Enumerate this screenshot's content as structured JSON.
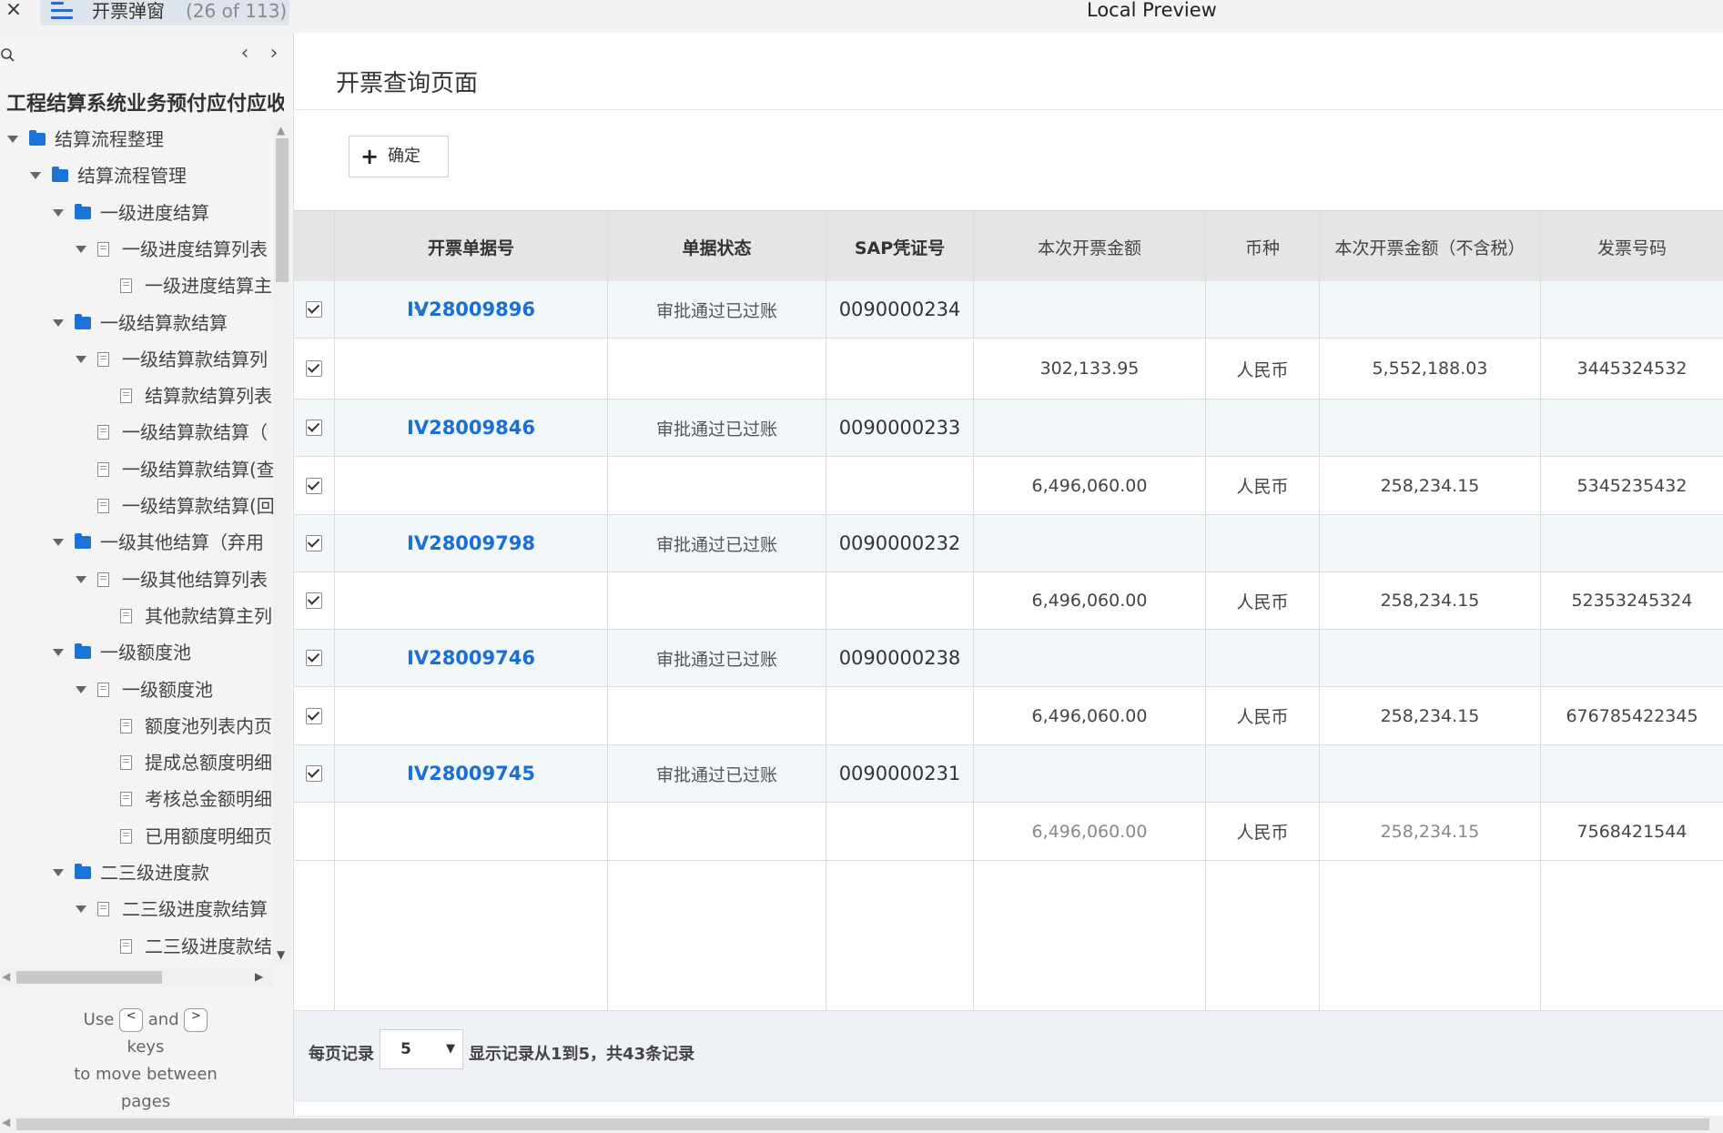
{
  "topbar": {
    "close_glyph": "×",
    "tab_title": "开票弹窗",
    "tab_count": "(26 of 113)",
    "window_title": "Local Preview"
  },
  "sidebar": {
    "prev_glyph": "‹",
    "next_glyph": "›",
    "heading": "工程结算系统业务预付应付应收",
    "tree": [
      {
        "label": "结算流程整理",
        "type": "folder",
        "level": 0,
        "expanded": true
      },
      {
        "label": "结算流程管理",
        "type": "folder",
        "level": 1,
        "expanded": true
      },
      {
        "label": "一级进度结算",
        "type": "folder",
        "level": 2,
        "expanded": true
      },
      {
        "label": "一级进度结算列表",
        "type": "page",
        "level": 3,
        "expanded": true
      },
      {
        "label": "一级进度结算主",
        "type": "page",
        "level": 4,
        "expanded": false
      },
      {
        "label": "一级结算款结算",
        "type": "folder",
        "level": 2,
        "expanded": true
      },
      {
        "label": "一级结算款结算列",
        "type": "page",
        "level": 3,
        "expanded": true
      },
      {
        "label": "结算款结算列表",
        "type": "page",
        "level": 4,
        "expanded": false
      },
      {
        "label": "一级结算款结算（",
        "type": "page",
        "level": 3,
        "expanded": false
      },
      {
        "label": "一级结算款结算(查",
        "type": "page",
        "level": 3,
        "expanded": false
      },
      {
        "label": "一级结算款结算(回",
        "type": "page",
        "level": 3,
        "expanded": false
      },
      {
        "label": "一级其他结算（弃用",
        "type": "folder",
        "level": 2,
        "expanded": true
      },
      {
        "label": "一级其他结算列表",
        "type": "page",
        "level": 3,
        "expanded": true
      },
      {
        "label": "其他款结算主列",
        "type": "page",
        "level": 4,
        "expanded": false
      },
      {
        "label": "一级额度池",
        "type": "folder",
        "level": 2,
        "expanded": true
      },
      {
        "label": "一级额度池",
        "type": "page",
        "level": 3,
        "expanded": true
      },
      {
        "label": "额度池列表内页",
        "type": "page",
        "level": 4,
        "expanded": false
      },
      {
        "label": "提成总额度明细",
        "type": "page",
        "level": 4,
        "expanded": false
      },
      {
        "label": "考核总金额明细",
        "type": "page",
        "level": 4,
        "expanded": false
      },
      {
        "label": "已用额度明细页",
        "type": "page",
        "level": 4,
        "expanded": false
      },
      {
        "label": "二三级进度款",
        "type": "folder",
        "level": 2,
        "expanded": true
      },
      {
        "label": "二三级进度款结算",
        "type": "page",
        "level": 3,
        "expanded": true
      },
      {
        "label": "二三级进度款结",
        "type": "page",
        "level": 4,
        "expanded": false
      }
    ],
    "hint": {
      "use": "Use",
      "key_prev": "<",
      "and": "and",
      "key_next": ">",
      "keys": "keys",
      "line2": "to move between",
      "line3": "pages"
    }
  },
  "main": {
    "page_title": "开票查询页面",
    "confirm_label": "确定",
    "columns": [
      "开票单据号",
      "单据状态",
      "SAP凭证号",
      "本次开票金额",
      "币种",
      "本次开票金额（不含税）",
      "发票号码"
    ],
    "groups": [
      {
        "invoice_no": "IV28009896",
        "status": "审批通过已过账",
        "sap_no": "0090000234",
        "expanded": true,
        "detail": {
          "amount": "302,133.95",
          "currency": "人民币",
          "amount_excl_tax": "5,552,188.03",
          "invoice_number": "3445324532",
          "checked": true
        }
      },
      {
        "invoice_no": "IV28009846",
        "status": "审批通过已过账",
        "sap_no": "0090000233",
        "expanded": false,
        "detail": {
          "amount": "6,496,060.00",
          "currency": "人民币",
          "amount_excl_tax": "258,234.15",
          "invoice_number": "5345235432",
          "checked": true
        }
      },
      {
        "invoice_no": "IV28009798",
        "status": "审批通过已过账",
        "sap_no": "0090000232",
        "expanded": false,
        "detail": {
          "amount": "6,496,060.00",
          "currency": "人民币",
          "amount_excl_tax": "258,234.15",
          "invoice_number": "52353245324",
          "checked": true
        }
      },
      {
        "invoice_no": "IV28009746",
        "status": "审批通过已过账",
        "sap_no": "0090000238",
        "expanded": false,
        "detail": {
          "amount": "6,496,060.00",
          "currency": "人民币",
          "amount_excl_tax": "258,234.15",
          "invoice_number": "676785422345",
          "checked": true
        }
      },
      {
        "invoice_no": "IV28009745",
        "status": "审批通过已过账",
        "sap_no": "0090000231",
        "expanded": false,
        "detail": {
          "amount": "6,496,060.00",
          "currency": "人民币",
          "amount_excl_tax": "258,234.15",
          "invoice_number": "7568421544",
          "checked": false
        }
      }
    ],
    "footer": {
      "per_page_label": "每页记录",
      "per_page_value": "5",
      "records_text": "显示记录从1到5，共43条记录"
    }
  },
  "colors": {
    "link": "#1a6fd6",
    "folder": "#1a73d8",
    "parent_row_bg": "#f2f7fa",
    "header_bg": "#e5e5e5"
  }
}
